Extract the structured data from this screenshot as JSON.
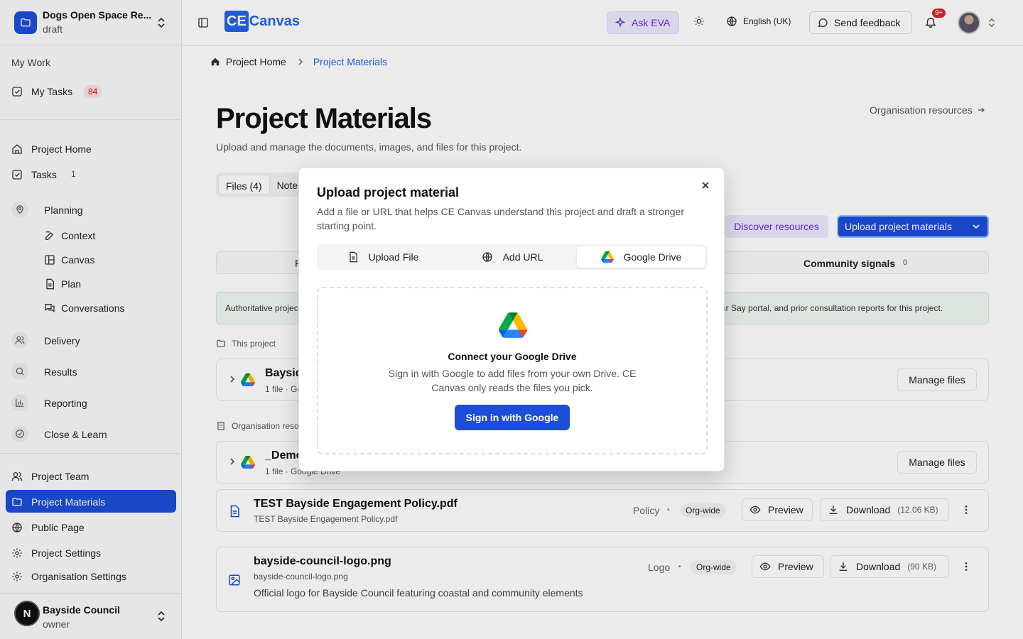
{
  "workspace": {
    "name": "Dogs Open Space Re...",
    "status": "draft"
  },
  "sidebar": {
    "my_work_label": "My Work",
    "my_tasks": {
      "label": "My Tasks",
      "count": "84"
    },
    "items": {
      "project_home": "Project Home",
      "tasks": {
        "label": "Tasks",
        "count": "1"
      },
      "planning": "Planning",
      "context": "Context",
      "canvas": "Canvas",
      "plan": "Plan",
      "conversations": "Conversations",
      "delivery": "Delivery",
      "results": "Results",
      "reporting": "Reporting",
      "close_learn": "Close & Learn",
      "project_team": "Project Team",
      "project_materials": "Project Materials",
      "public_page": "Public Page",
      "project_settings": "Project Settings",
      "org_settings": "Organisation Settings"
    },
    "user": {
      "initial": "N",
      "name": "Bayside Council",
      "role": "owner"
    }
  },
  "header": {
    "logo_ce": "CE",
    "logo_canvas": "Canvas",
    "ask_eva": "Ask EVA",
    "language": "English (UK)",
    "feedback": "Send feedback",
    "notifications_badge": "9+"
  },
  "breadcrumb": {
    "home": "Project Home",
    "current": "Project Materials"
  },
  "page": {
    "title": "Project Materials",
    "description": "Upload and manage the documents, images, and files for this project.",
    "org_resources_link": "Organisation resources",
    "tabs": [
      "Files (4)",
      "Notes"
    ],
    "discover_button": "Discover resources",
    "upload_button": "Upload project materials",
    "subtab_left": "F",
    "community_signals": {
      "label": "Community signals",
      "count": "0"
    },
    "info_left": "Authoritative projec",
    "info_right": "ur Say portal, and prior consultation reports for this project.",
    "section_this_project": "This project",
    "section_org": "Organisation reso",
    "drive_cards": [
      {
        "title": "Baysid",
        "meta": "1 file · Go",
        "action": "Manage files"
      },
      {
        "title": "_Demo",
        "meta": "1 file · Google Drive",
        "action": "Manage files"
      }
    ],
    "files": [
      {
        "title": "TEST Bayside Engagement Policy.pdf",
        "filename": "TEST Bayside Engagement Policy.pdf",
        "description": "",
        "category": "Policy",
        "scope": "Org-wide",
        "preview": "Preview",
        "download": "Download",
        "size": "(12.06 KB)"
      },
      {
        "title": "bayside-council-logo.png",
        "filename": "bayside-council-logo.png",
        "description": "Official logo for Bayside Council featuring coastal and community elements",
        "category": "Logo",
        "scope": "Org-wide",
        "preview": "Preview",
        "download": "Download",
        "size": "(90 KB)"
      }
    ]
  },
  "modal": {
    "title": "Upload project material",
    "description": "Add a file or URL that helps CE Canvas understand this project and draft a stronger starting point.",
    "tabs": [
      "Upload File",
      "Add URL",
      "Google Drive"
    ],
    "active_tab": "Google Drive",
    "connect_title": "Connect your Google Drive",
    "connect_desc": "Sign in with Google to add files from your own Drive. CE Canvas only reads the files you pick.",
    "sign_in_button": "Sign in with Google"
  },
  "colors": {
    "accent": "#1d4ed8",
    "brand": "#2563eb",
    "eva": "#6d28d9",
    "alert": "#dc2626"
  },
  "icons": [
    "folder-icon",
    "chevrons-updown-icon",
    "sidebar-toggle-icon",
    "sparkles-icon",
    "sun-icon",
    "globe-icon",
    "message-icon",
    "bell-icon",
    "home-icon",
    "arrow-right-icon",
    "google-drive-icon",
    "file-icon",
    "image-icon",
    "eye-icon",
    "download-icon",
    "more-vertical-icon",
    "close-icon",
    "link-icon"
  ]
}
